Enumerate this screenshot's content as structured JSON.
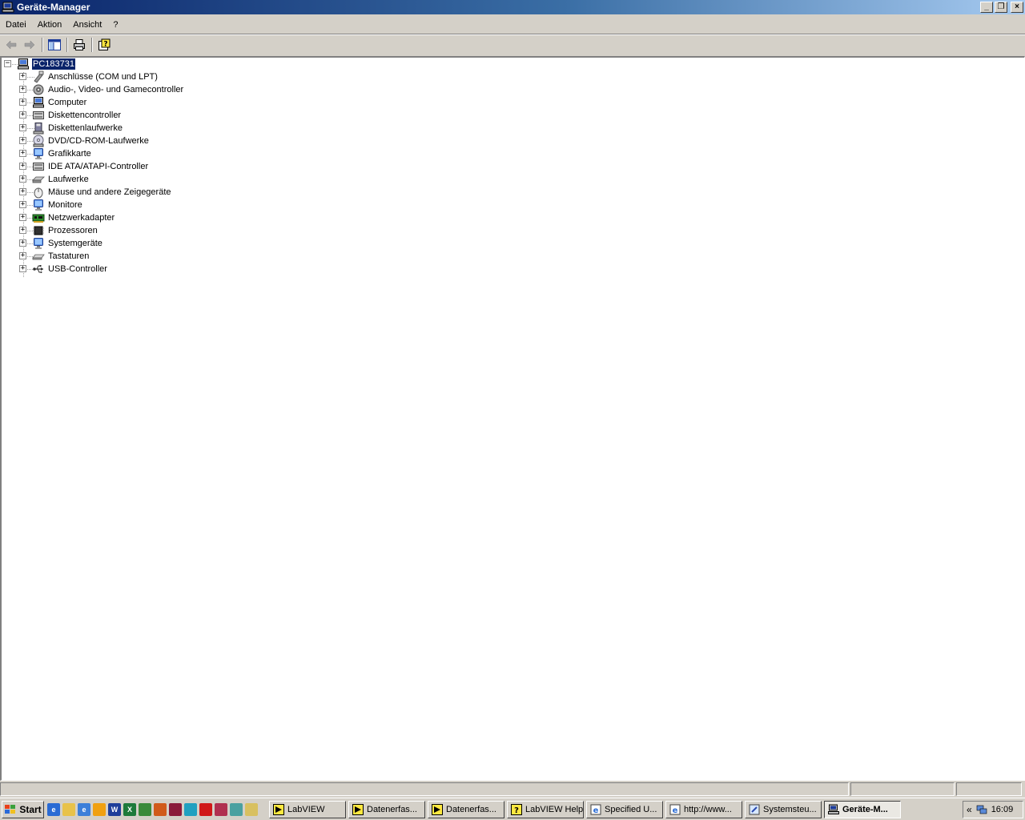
{
  "window": {
    "title": "Geräte-Manager",
    "caption_buttons": {
      "minimize": "_",
      "restore": "❐",
      "close": "×"
    }
  },
  "menu": [
    "Datei",
    "Aktion",
    "Ansicht",
    "?"
  ],
  "toolbar": [
    "back",
    "forward",
    "show-hide-console-tree",
    "print",
    "help"
  ],
  "tree": {
    "root": {
      "label": "PC183731",
      "expander": "−",
      "icon": "computer-icon",
      "selected": true
    },
    "children": [
      {
        "label": "Anschlüsse (COM und LPT)",
        "expander": "+",
        "icon": "port-icon"
      },
      {
        "label": "Audio-, Video- und Gamecontroller",
        "expander": "+",
        "icon": "speaker-icon"
      },
      {
        "label": "Computer",
        "expander": "+",
        "icon": "computer-icon"
      },
      {
        "label": "Diskettencontroller",
        "expander": "+",
        "icon": "controller-icon"
      },
      {
        "label": "Diskettenlaufwerke",
        "expander": "+",
        "icon": "floppy-icon"
      },
      {
        "label": "DVD/CD-ROM-Laufwerke",
        "expander": "+",
        "icon": "cdrom-icon"
      },
      {
        "label": "Grafikkarte",
        "expander": "+",
        "icon": "display-icon"
      },
      {
        "label": "IDE ATA/ATAPI-Controller",
        "expander": "+",
        "icon": "controller-icon"
      },
      {
        "label": "Laufwerke",
        "expander": "+",
        "icon": "harddisk-icon"
      },
      {
        "label": "Mäuse und andere Zeigegeräte",
        "expander": "+",
        "icon": "mouse-icon"
      },
      {
        "label": "Monitore",
        "expander": "+",
        "icon": "monitor-icon"
      },
      {
        "label": "Netzwerkadapter",
        "expander": "+",
        "icon": "network-card-icon"
      },
      {
        "label": "Prozessoren",
        "expander": "+",
        "icon": "processor-icon"
      },
      {
        "label": "Systemgeräte",
        "expander": "+",
        "icon": "system-device-icon"
      },
      {
        "label": "Tastaturen",
        "expander": "+",
        "icon": "keyboard-icon"
      },
      {
        "label": "USB-Controller",
        "expander": "+",
        "icon": "usb-icon"
      }
    ]
  },
  "taskbar": {
    "start_label": "Start",
    "quick_launch": [
      {
        "icon": "internet-explorer-icon",
        "color": "#2a6bd4",
        "text": "e"
      },
      {
        "icon": "folder-icon",
        "color": "#e8c24a",
        "text": ""
      },
      {
        "icon": "browser-icon",
        "color": "#3c7fd9",
        "text": "e"
      },
      {
        "icon": "media-icon",
        "color": "#f0a010",
        "text": ""
      },
      {
        "icon": "word-icon",
        "color": "#1f3f9a",
        "text": "W"
      },
      {
        "icon": "excel-icon",
        "color": "#1d7a3a",
        "text": "X"
      },
      {
        "icon": "app-icon",
        "color": "#3a8a3a",
        "text": ""
      },
      {
        "icon": "powerpoint-icon",
        "color": "#d05a1a",
        "text": ""
      },
      {
        "icon": "acrobat-icon",
        "color": "#8a1a3a",
        "text": ""
      },
      {
        "icon": "bosch-icon",
        "color": "#20a0c0",
        "text": ""
      },
      {
        "icon": "red-app-icon",
        "color": "#d01818",
        "text": ""
      },
      {
        "icon": "network-icon",
        "color": "#b03050",
        "text": ""
      },
      {
        "icon": "tools-icon",
        "color": "#4aa0a0",
        "text": ""
      },
      {
        "icon": "notes-icon",
        "color": "#d8c060",
        "text": ""
      }
    ],
    "tasks": [
      {
        "label": "LabVIEW",
        "icon": "labview-icon",
        "active": false
      },
      {
        "label": "Datenerfas...",
        "icon": "labview-icon",
        "active": false
      },
      {
        "label": "Datenerfas...",
        "icon": "labview-icon",
        "active": false
      },
      {
        "label": "LabVIEW Help",
        "icon": "help-icon",
        "active": false
      },
      {
        "label": "Specified U...",
        "icon": "ie-icon",
        "active": false
      },
      {
        "label": "http://www...",
        "icon": "ie-icon",
        "active": false
      },
      {
        "label": "Systemsteu...",
        "icon": "control-panel-icon",
        "active": false
      },
      {
        "label": "Geräte-M...",
        "icon": "device-manager-icon",
        "active": true
      }
    ],
    "tray": {
      "chevron": "«",
      "clock": "16:09"
    }
  },
  "colors": {
    "title_active": "#0a246a",
    "face": "#d4d0c8",
    "selection": "#0a246a"
  }
}
